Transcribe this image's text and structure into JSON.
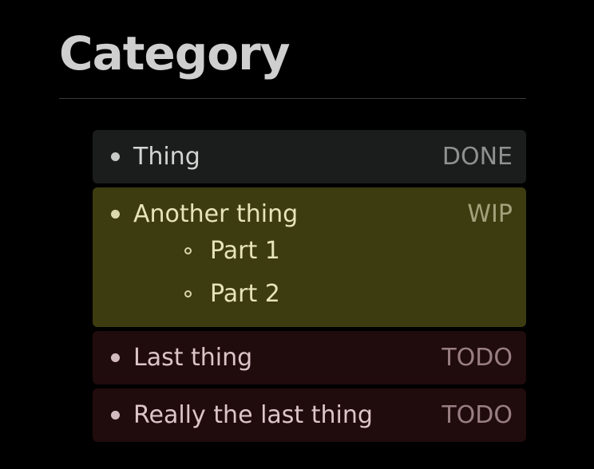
{
  "page": {
    "heading": "Category"
  },
  "items": [
    {
      "label": "Thing",
      "status": "DONE",
      "subitems": []
    },
    {
      "label": "Another thing",
      "status": "WIP",
      "subitems": [
        {
          "label": "Part 1"
        },
        {
          "label": "Part 2"
        }
      ]
    },
    {
      "label": "Last thing",
      "status": "TODO",
      "subitems": []
    },
    {
      "label": "Really the last thing",
      "status": "TODO",
      "subitems": []
    }
  ],
  "colors": {
    "background": "#000000",
    "heading": "#cfcfcf",
    "done_bg": "#1b1d1c",
    "wip_bg": "#3d3c11",
    "todo_bg": "#200b0d"
  }
}
